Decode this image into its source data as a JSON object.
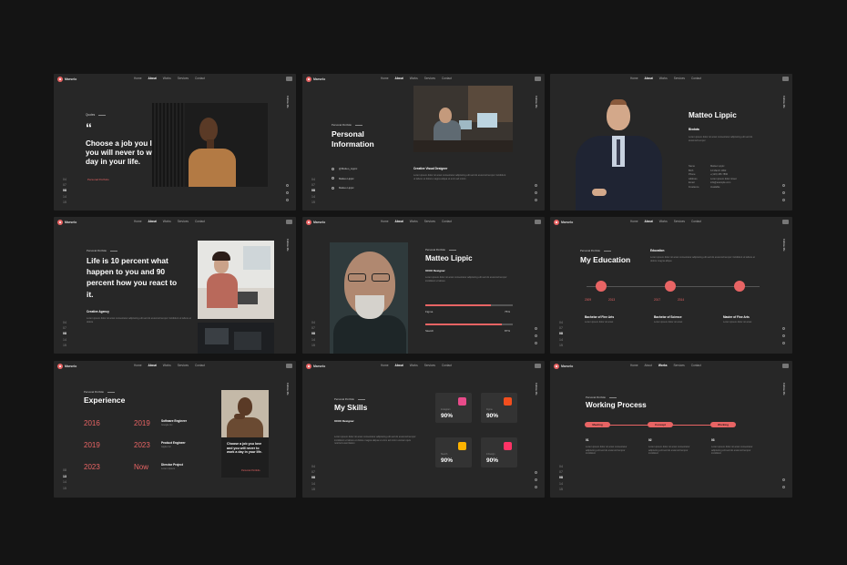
{
  "brand": "Marselo",
  "menu": {
    "items": [
      "Home",
      "About",
      "Works",
      "Services",
      "Contact"
    ]
  },
  "side_label": "Follow Me",
  "slides": {
    "s1": {
      "kicker": "Quotes",
      "quote_mark": "“",
      "quote": "Choose a job you love and you will never to work a day in your life.",
      "link": "Personal Portfolio",
      "pages": [
        "04",
        "07",
        "08",
        "14",
        "15"
      ],
      "current_page": "08"
    },
    "s2": {
      "kicker": "Personal Portfolio",
      "title_line1": "Personal",
      "title_line2": "Information",
      "contacts": [
        "@Matteo_Lippic",
        "Matteo Lippic",
        "Matteo Lippic"
      ],
      "subtitle": "Creative Visual Designer",
      "body": "Lorem ipsum dolor sit amet consectetur adipiscing elit sed do eiusmod tempor incididunt ut labore et dolore magna aliqua ut enim ad minim",
      "pages": [
        "04",
        "07",
        "08",
        "14",
        "15"
      ]
    },
    "s3": {
      "title": "Matteo Lippic",
      "subtitle": "Biodata",
      "body": "Lorem ipsum dolor sit amet consectetur adipiscing elit sed do eiusmod tempor",
      "rows": [
        [
          "Name",
          "Matteo Lippic"
        ],
        [
          "Birth",
          "12 March 1992"
        ],
        [
          "Phone",
          "+(123) 456 7890"
        ],
        [
          "Address",
          "Lorem ipsum dolor street"
        ],
        [
          "Email",
          "info@example.com"
        ],
        [
          "Freelance",
          "Available"
        ]
      ]
    },
    "s4": {
      "kicker": "Personal Portfolio",
      "title": "Life is 10 percent what happen to you and 90 percent how you react to it.",
      "subtitle": "Creative Agency",
      "body": "Lorem ipsum dolor sit amet consectetur adipiscing elit sed do eiusmod tempor incididunt ut labore et dolore",
      "pages": [
        "04",
        "07",
        "08",
        "14",
        "15"
      ]
    },
    "s5": {
      "kicker": "Personal Portfolio",
      "title": "Matteo Lippic",
      "subtitle": "UI/UX Designer",
      "body": "Lorem ipsum dolor sit amet consectetur adipiscing elit sed do eiusmod tempor incididunt ut labore",
      "skills": [
        {
          "name": "Figma",
          "label": "75%",
          "value": 75
        },
        {
          "name": "Sketch",
          "label": "87%",
          "value": 87
        }
      ],
      "pages": [
        "04",
        "07",
        "08",
        "14",
        "15"
      ]
    },
    "s6": {
      "kicker": "Personal Portfolio",
      "title": "My Education",
      "section": "Education",
      "body": "Lorem ipsum dolor sit amet consectetur adipiscing elit sed do eiusmod tempor incididunt ut labore et dolore magna aliqua",
      "items": [
        {
          "from": "2009",
          "to": "2013",
          "degree": "Bachelor of Fine Arts"
        },
        {
          "from": "2017",
          "to": "2014",
          "degree": "Bachelor of Science"
        },
        {
          "from": "",
          "to": "",
          "degree": "Master of Fine Arts"
        }
      ],
      "item_desc": "Lorem ipsum dolor sit amet",
      "pages": [
        "04",
        "07",
        "08",
        "14",
        "15"
      ]
    },
    "s7": {
      "kicker": "Personal Portfolio",
      "title": "Experience",
      "rows": [
        {
          "from": "2016",
          "to": "2019",
          "role": "Software Engineer",
          "desc": "Google Inc"
        },
        {
          "from": "2019",
          "to": "2023",
          "role": "Product Engineer",
          "desc": "Apple Inc"
        },
        {
          "from": "2023",
          "to": "Now",
          "role": "Director Project",
          "desc": "Lorem Ipsum"
        }
      ],
      "card_quote": "Choose a job you love and you will never to work a day in your life.",
      "card_link": "Personal Portfolio",
      "pages": [
        "08",
        "13",
        "14",
        "15"
      ]
    },
    "s8": {
      "kicker": "Personal Portfolio",
      "title": "My Skills",
      "subtitle": "UI/UX Designer",
      "body": "Lorem ipsum dolor sit amet consectetur adipiscing elit sed do eiusmod tempor incididunt ut labore et dolore magna aliqua ut enim ad minim veniam quis nostrud exercitation",
      "tiles": [
        {
          "label": "Instagram",
          "value": "90%",
          "color": "#e84b8a"
        },
        {
          "label": "Figma",
          "value": "90%",
          "color": "#f24e1e"
        },
        {
          "label": "Sketch",
          "value": "90%",
          "color": "#fdb300"
        },
        {
          "label": "InDesign",
          "value": "90%",
          "color": "#ff3366"
        }
      ],
      "pages": [
        "04",
        "07",
        "08",
        "14",
        "15"
      ]
    },
    "s9": {
      "kicker": "Personal Portfolio",
      "title": "Working Process",
      "steps": [
        {
          "label": "Meeting",
          "num": "01"
        },
        {
          "label": "Concept",
          "num": "02"
        },
        {
          "label": "Working",
          "num": "03"
        }
      ],
      "step_desc": "Lorem ipsum dolor sit amet consectetur adipiscing elit sed do eiusmod tempor incididunt",
      "pages": [
        "04",
        "07",
        "08",
        "14",
        "15"
      ]
    }
  },
  "colors": {
    "accent": "#e86464",
    "slide_bg": "#272727",
    "page_bg": "#141414"
  }
}
